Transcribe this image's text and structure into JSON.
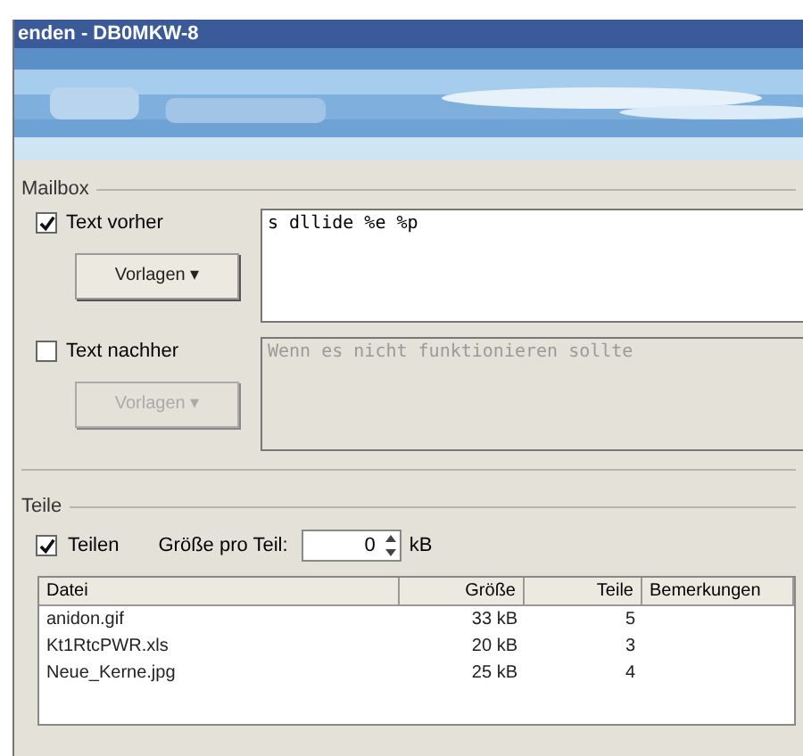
{
  "window": {
    "title": "enden - DB0MKW-8"
  },
  "mailbox": {
    "title": "Mailbox",
    "before": {
      "label": "Text vorher",
      "checked": true,
      "button": "Vorlagen ▾",
      "disabled": false,
      "value": "s dllide %e %p"
    },
    "after": {
      "label": "Text nachher",
      "checked": false,
      "button": "Vorlagen ▾",
      "disabled": true,
      "placeholder": "Wenn es nicht funktionieren sollte"
    }
  },
  "parts": {
    "title": "Teile",
    "split": {
      "label": "Teilen",
      "checked": true
    },
    "size_label": "Größe pro Teil:",
    "size_value": "0",
    "unit": "kB",
    "table": {
      "columns": [
        "Datei",
        "Größe",
        "Teile",
        "Bemerkungen"
      ],
      "rows": [
        {
          "cells": [
            "anidon.gif",
            "33 kB",
            "5"
          ]
        },
        {
          "cells": [
            "Kt1RtcPWR.xls",
            "20 kB",
            "3"
          ]
        },
        {
          "cells": [
            "Neue_Kerne.jpg",
            "25 kB",
            "4"
          ]
        }
      ]
    }
  }
}
